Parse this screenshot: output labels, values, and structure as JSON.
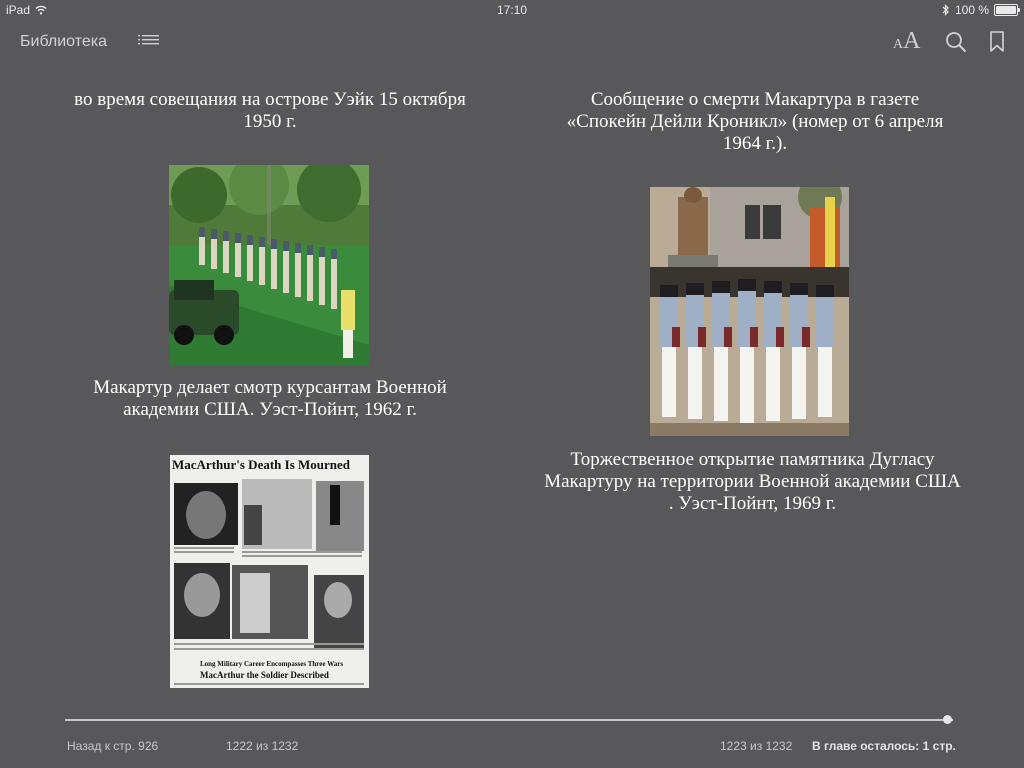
{
  "status_bar": {
    "device": "iPad",
    "time": "17:10",
    "battery": "100 %",
    "battery_level": 1.0
  },
  "toolbar": {
    "library_label": "Библиотека",
    "font_size_small": "A",
    "font_size_large": "A"
  },
  "content": {
    "left_top_caption": "во время совещания на острове Уэйк 15 октября 1950 г.",
    "left_photo_caption": "Макартур делает смотр курсантам Военной академии США. Уэст-Пойнт, 1962 г.",
    "newspaper": {
      "headline": "MacArthur's Death Is Mourned",
      "subhead_1": "Long Military Career Encompasses Three Wars",
      "subhead_2": "MacArthur the Soldier Described"
    },
    "right_top_caption": "Сообщение о смерти Макартура в газете «Спокейн Дейли Кроникл» (номер от 6 апреля 1964 г.).",
    "right_photo_caption": "Торжественное открытие памятника Дугласу Макартуру на территории Военной академии США . Уэст-Пойнт, 1969 г."
  },
  "footer": {
    "back_link": "Назад к стр. 926",
    "left_page": "1222 из 1232",
    "right_page": "1223 из 1232",
    "chapter_remaining": "В главе осталось: 1 стр.",
    "progress": 0.993
  }
}
